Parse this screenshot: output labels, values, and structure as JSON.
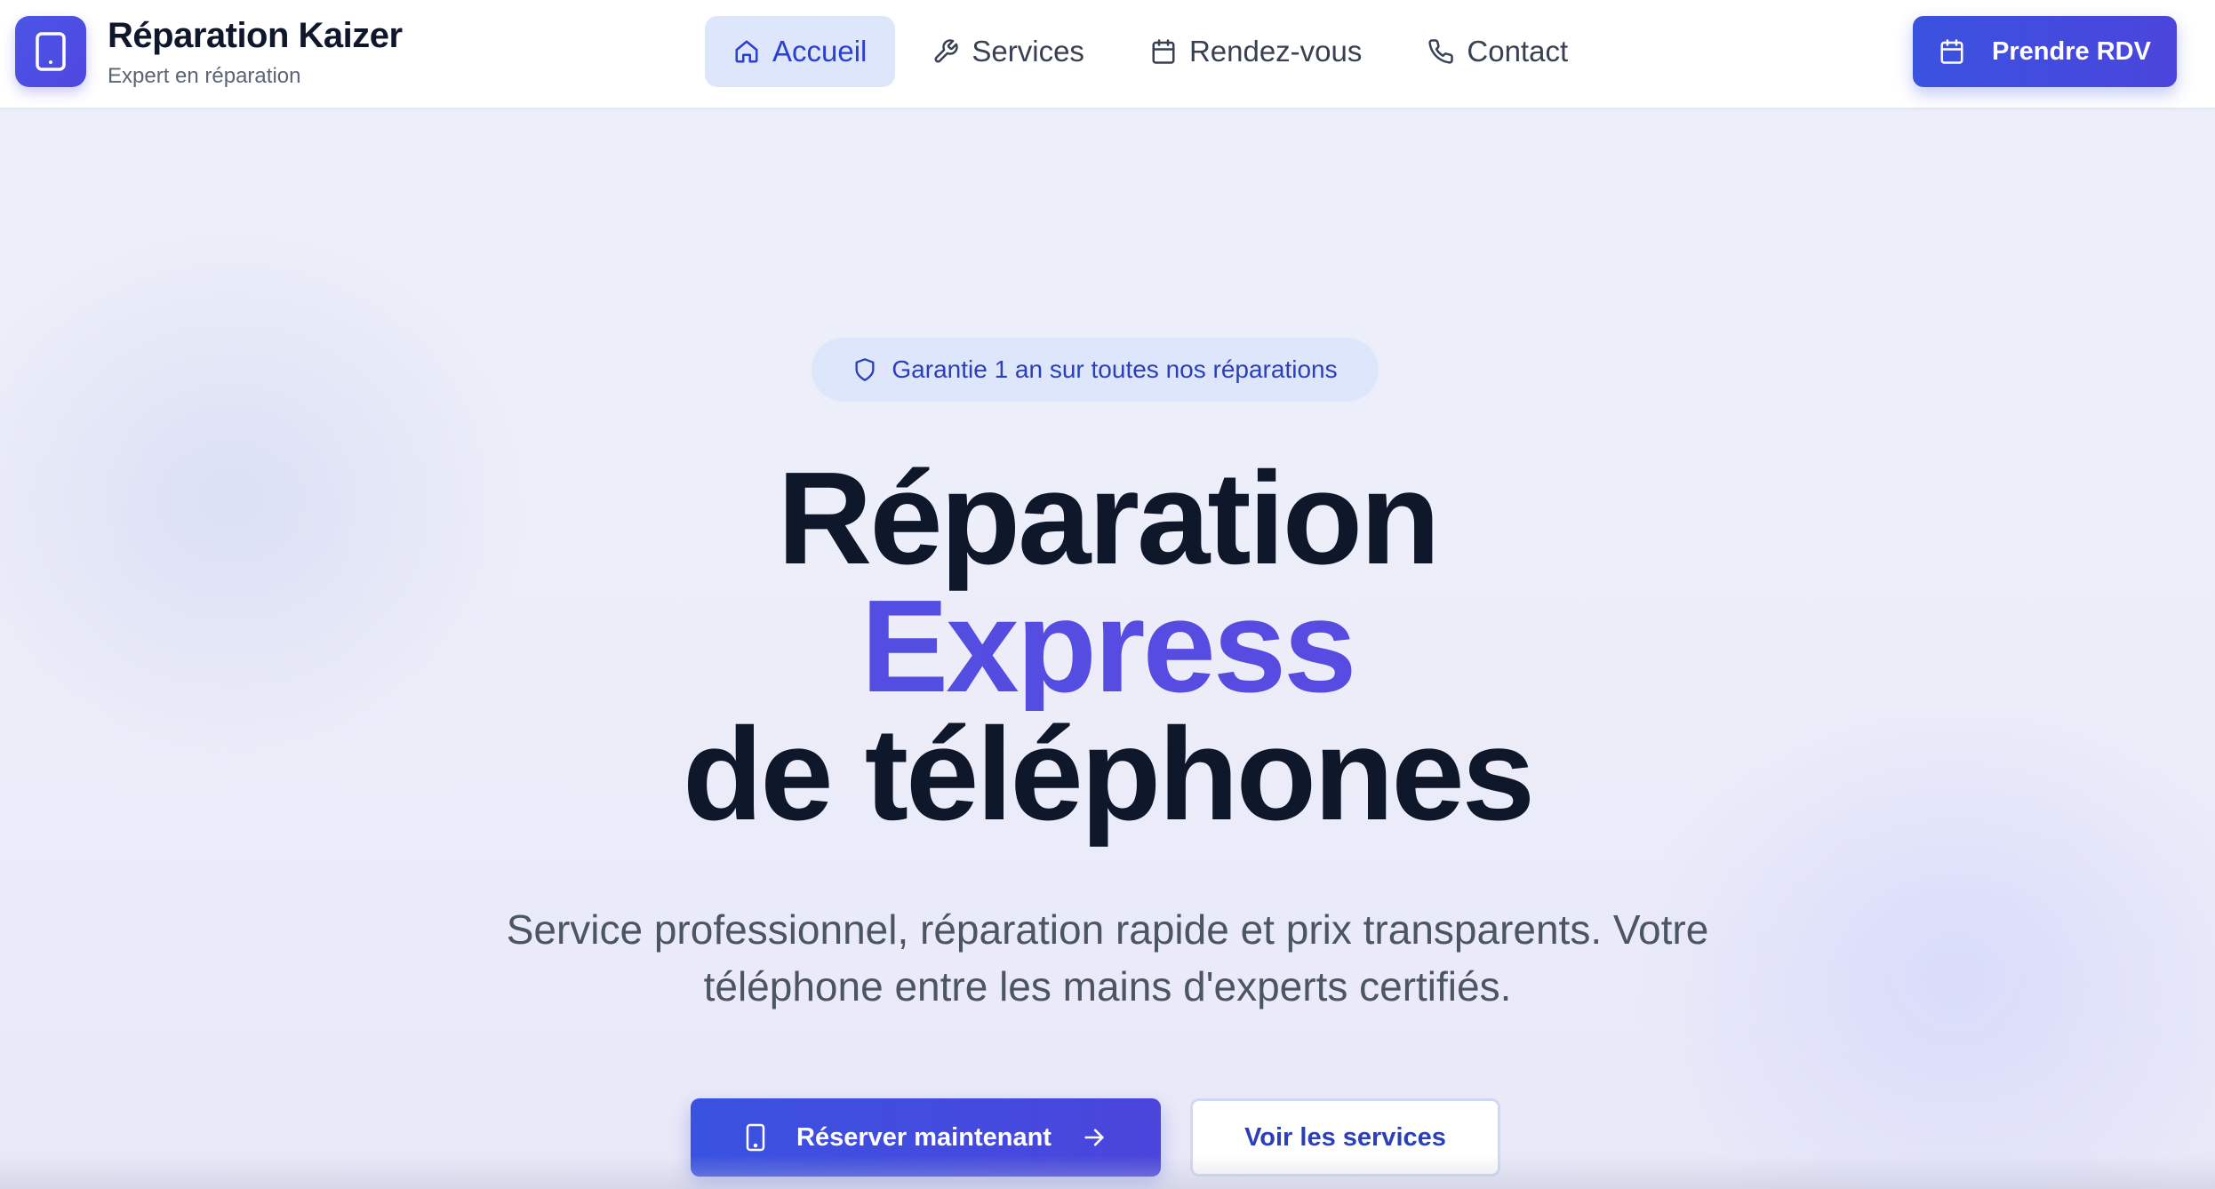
{
  "brand": {
    "title": "Réparation Kaizer",
    "subtitle": "Expert en réparation",
    "icon": "smartphone-icon"
  },
  "nav": {
    "items": [
      {
        "label": "Accueil",
        "icon": "home-icon",
        "active": true
      },
      {
        "label": "Services",
        "icon": "wrench-icon",
        "active": false
      },
      {
        "label": "Rendez-vous",
        "icon": "calendar-icon",
        "active": false
      },
      {
        "label": "Contact",
        "icon": "phone-icon",
        "active": false
      }
    ]
  },
  "header_cta": {
    "label": "Prendre RDV",
    "icon": "calendar-icon"
  },
  "hero": {
    "badge": {
      "text": "Garantie 1 an sur toutes nos réparations",
      "icon": "shield-icon"
    },
    "title_line1": "Réparation",
    "title_accent": "Express",
    "title_line3": "de téléphones",
    "description": "Service professionnel, réparation rapide et prix transparents. Votre téléphone entre les mains d'experts certifiés.",
    "primary_button": {
      "label": "Réserver maintenant",
      "icon": "smartphone-icon",
      "trailing_icon": "arrow-right-icon"
    },
    "secondary_button": {
      "label": "Voir les services"
    }
  },
  "colors": {
    "accent": "#4f46e5",
    "primary_button": "#3a52e0",
    "active_nav_bg": "#dde6fb",
    "heading": "#0f172a",
    "body_text": "#4b5563"
  }
}
